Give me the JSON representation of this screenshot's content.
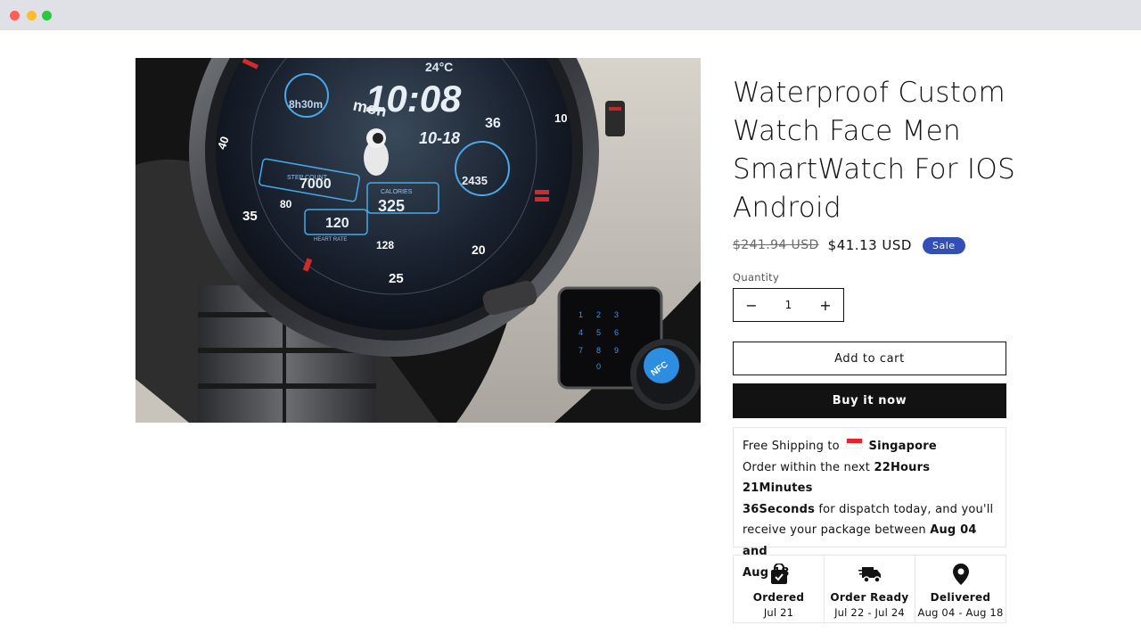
{
  "product": {
    "title": "Waterproof Custom Watch Face Men SmartWatch For IOS Android",
    "old_price": "$241.94 USD",
    "new_price": "$41.13 USD",
    "sale_badge": "Sale",
    "image_texts": {
      "temp": "24°C",
      "time": "10:08",
      "seconds": "36",
      "day": "mon",
      "date": "10-18",
      "moon": "8h30m",
      "steps_label": "STEP COUNT",
      "steps": "7000",
      "calories_label": "CALORIES",
      "calories": "325",
      "heart": "120",
      "heart_label": "HEART RATE",
      "altitude": "2435",
      "nfc": "NFC",
      "dial_numbers": [
        "10",
        "40",
        "35",
        "80",
        "128",
        "20",
        "25"
      ]
    }
  },
  "quantity": {
    "label": "Quantity",
    "value": "1",
    "minus": "−",
    "plus": "+"
  },
  "buttons": {
    "add_to_cart": "Add to cart",
    "buy_now": "Buy it now"
  },
  "shipping": {
    "free_shipping_to": "Free Shipping to",
    "country": "Singapore",
    "order_within": "Order within the next",
    "countdown_1": "22Hours 21Minutes",
    "countdown_2": "36Seconds",
    "dispatch_text": "for dispatch today, and you'll",
    "receive_text": "receive your package between",
    "range_1": "Aug 04 and",
    "range_2": "Aug 18"
  },
  "steps": [
    {
      "icon": "shopping-bag-check-icon",
      "title": "Ordered",
      "date": "Jul 21"
    },
    {
      "icon": "delivery-truck-icon",
      "title": "Order Ready",
      "date": "Jul 22 - Jul 24"
    },
    {
      "icon": "map-pin-icon",
      "title": "Delivered",
      "date": "Aug 04 - Aug 18"
    }
  ],
  "colors": {
    "sale_badge": "#334fb4",
    "buy_now_bg": "#121212",
    "flag_red": "#e0242b"
  }
}
